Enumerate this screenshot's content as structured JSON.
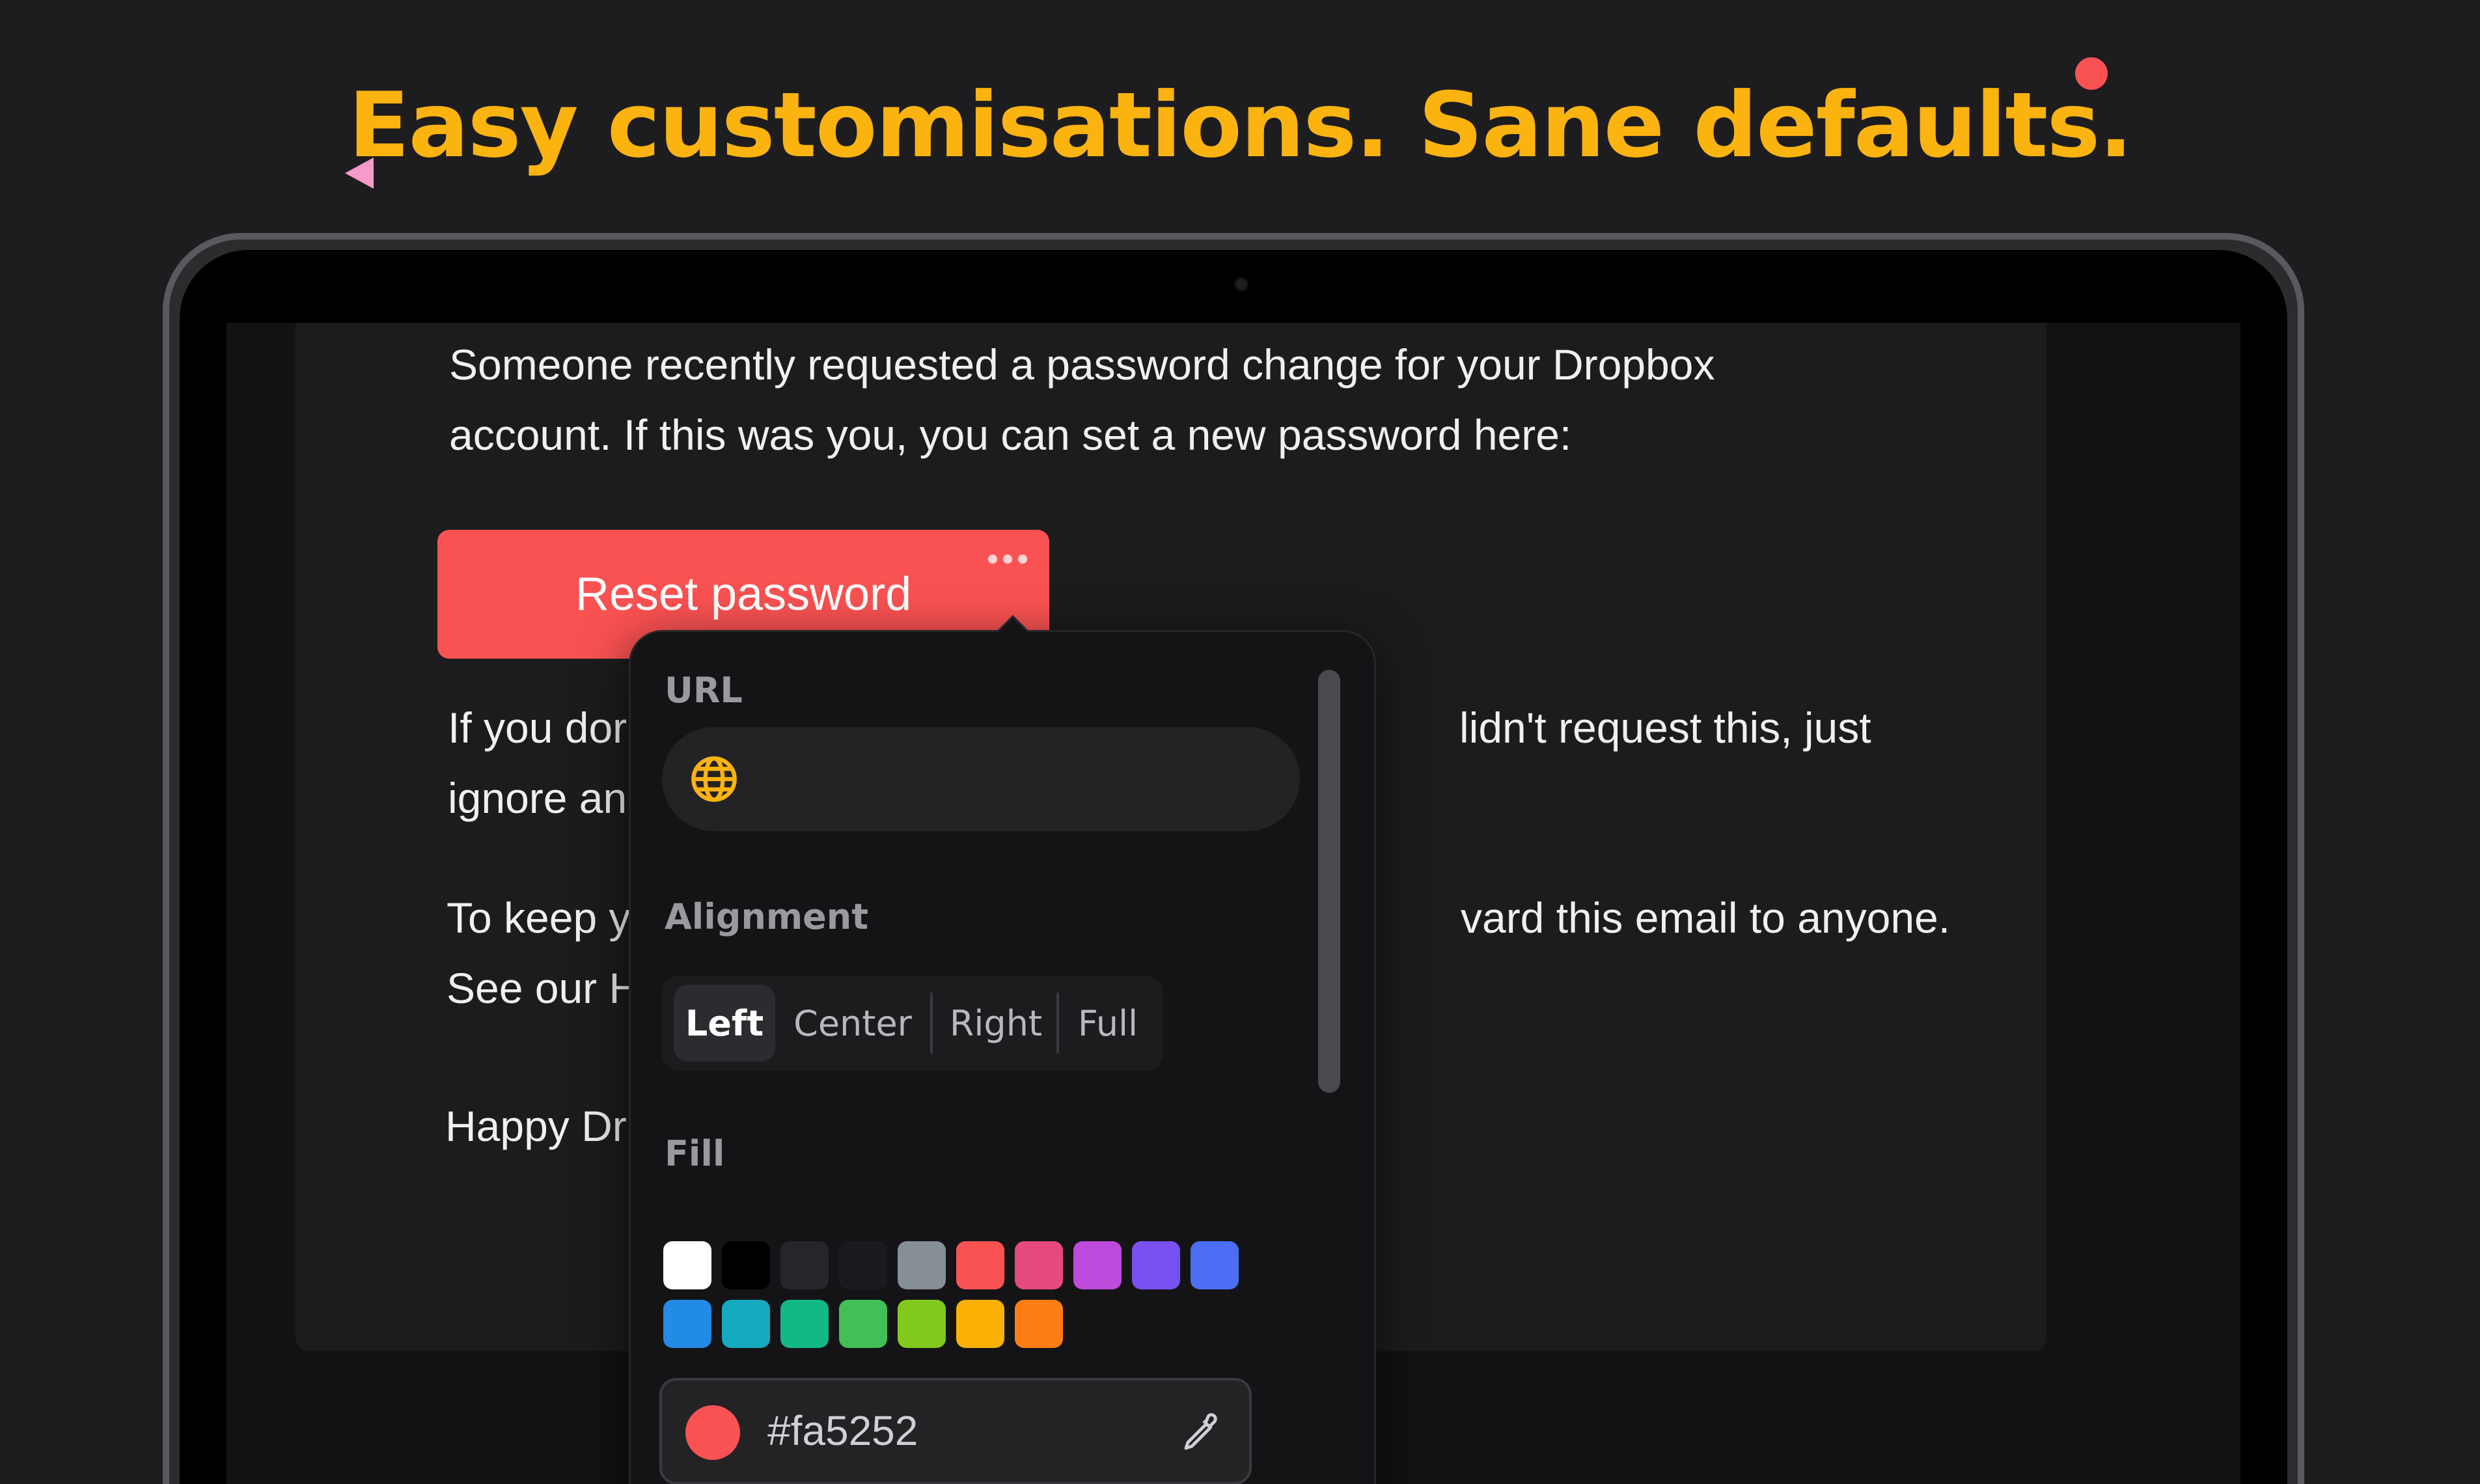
{
  "headline": "Easy customisations. Sane defaults.",
  "email": {
    "line1": "Someone recently requested a password change for your Dropbox",
    "line2": "account. If this was you, you can set a new password here:",
    "button_label": "Reset password",
    "p2a_left": "If you dor",
    "p2a_right": "lidn't request this, just",
    "p2b_left": "ignore and",
    "p3a_left": "To keep y",
    "p3a_right": "vard this email to anyone.",
    "p3b_left": "See our H",
    "sign_left": "Happy Dr"
  },
  "popover": {
    "url_label": "URL",
    "url_value": "",
    "alignment_label": "Alignment",
    "alignment_options": [
      "Left",
      "Center",
      "Right",
      "Full"
    ],
    "alignment_selected": "Left",
    "fill_label": "Fill",
    "swatches": [
      "#ffffff",
      "#000000",
      "#25262b",
      "#1a1b1e",
      "#868e96",
      "#fa5252",
      "#e64980",
      "#be4bdb",
      "#7950f2",
      "#4c6ef5",
      "#228be6",
      "#15aabf",
      "#12b886",
      "#40c057",
      "#82c91e",
      "#fab005",
      "#fd7e14"
    ],
    "hex_value": "#fa5252"
  },
  "colors": {
    "accent": "#fbb310",
    "button": "#fa5252"
  }
}
